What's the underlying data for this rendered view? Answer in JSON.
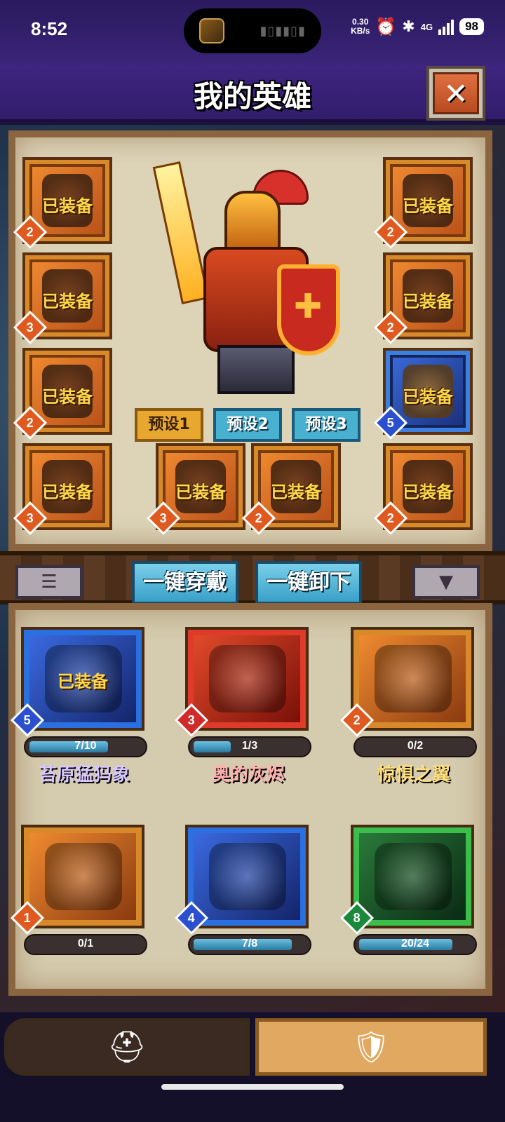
{
  "status_bar": {
    "time": "8:52",
    "net_speed_value": "0.30",
    "net_speed_unit": "KB/s",
    "network": "4G",
    "battery": "98"
  },
  "header": {
    "title": "我的英雄",
    "close_symbol": "✕"
  },
  "equip_slots": [
    {
      "label": "已装备",
      "level": "2",
      "color": "orange"
    },
    {
      "label": "已装备",
      "level": "3",
      "color": "orange"
    },
    {
      "label": "已装备",
      "level": "2",
      "color": "orange"
    },
    {
      "label": "已装备",
      "level": "3",
      "color": "orange"
    },
    {
      "label": "已装备",
      "level": "3",
      "color": "orange"
    },
    {
      "label": "已装备",
      "level": "2",
      "color": "orange"
    },
    {
      "label": "已装备",
      "level": "2",
      "color": "orange"
    },
    {
      "label": "已装备",
      "level": "2",
      "color": "orange"
    },
    {
      "label": "已装备",
      "level": "5",
      "color": "blue"
    },
    {
      "label": "已装备",
      "level": "2",
      "color": "orange"
    }
  ],
  "presets": [
    {
      "label": "预设1",
      "active": true
    },
    {
      "label": "预设2",
      "active": false
    },
    {
      "label": "预设3",
      "active": false
    }
  ],
  "actions": {
    "equip_all": "一键穿戴",
    "unequip_all": "一键卸下",
    "list_icon": "list-icon",
    "filter_icon": "filter-icon"
  },
  "inventory": [
    {
      "name": "苔原猛犸象",
      "level": "5",
      "progress_text": "7/10",
      "progress": 0.7,
      "equipped_label": "已装备",
      "frame": "blue",
      "name_color": "#d8c8ff"
    },
    {
      "name": "奥的灰烬",
      "level": "3",
      "progress_text": "1/3",
      "progress": 0.33,
      "equipped_label": "",
      "frame": "red",
      "name_color": "#ffb0b0"
    },
    {
      "name": "惊惧之翼",
      "level": "2",
      "progress_text": "0/2",
      "progress": 0,
      "equipped_label": "",
      "frame": "orange",
      "name_color": "#ffe080"
    },
    {
      "name": "",
      "level": "1",
      "progress_text": "0/1",
      "progress": 0,
      "equipped_label": "",
      "frame": "orange",
      "name_color": "#ffffff"
    },
    {
      "name": "",
      "level": "4",
      "progress_text": "7/8",
      "progress": 0.875,
      "equipped_label": "",
      "frame": "blue",
      "name_color": "#d8c8ff"
    },
    {
      "name": "",
      "level": "8",
      "progress_text": "20/24",
      "progress": 0.83,
      "equipped_label": "",
      "frame": "green",
      "name_color": "#b0ffb0"
    }
  ],
  "bottom_tabs": [
    {
      "icon": "helmet-icon",
      "active": false
    },
    {
      "icon": "armor-icon",
      "active": true
    }
  ]
}
